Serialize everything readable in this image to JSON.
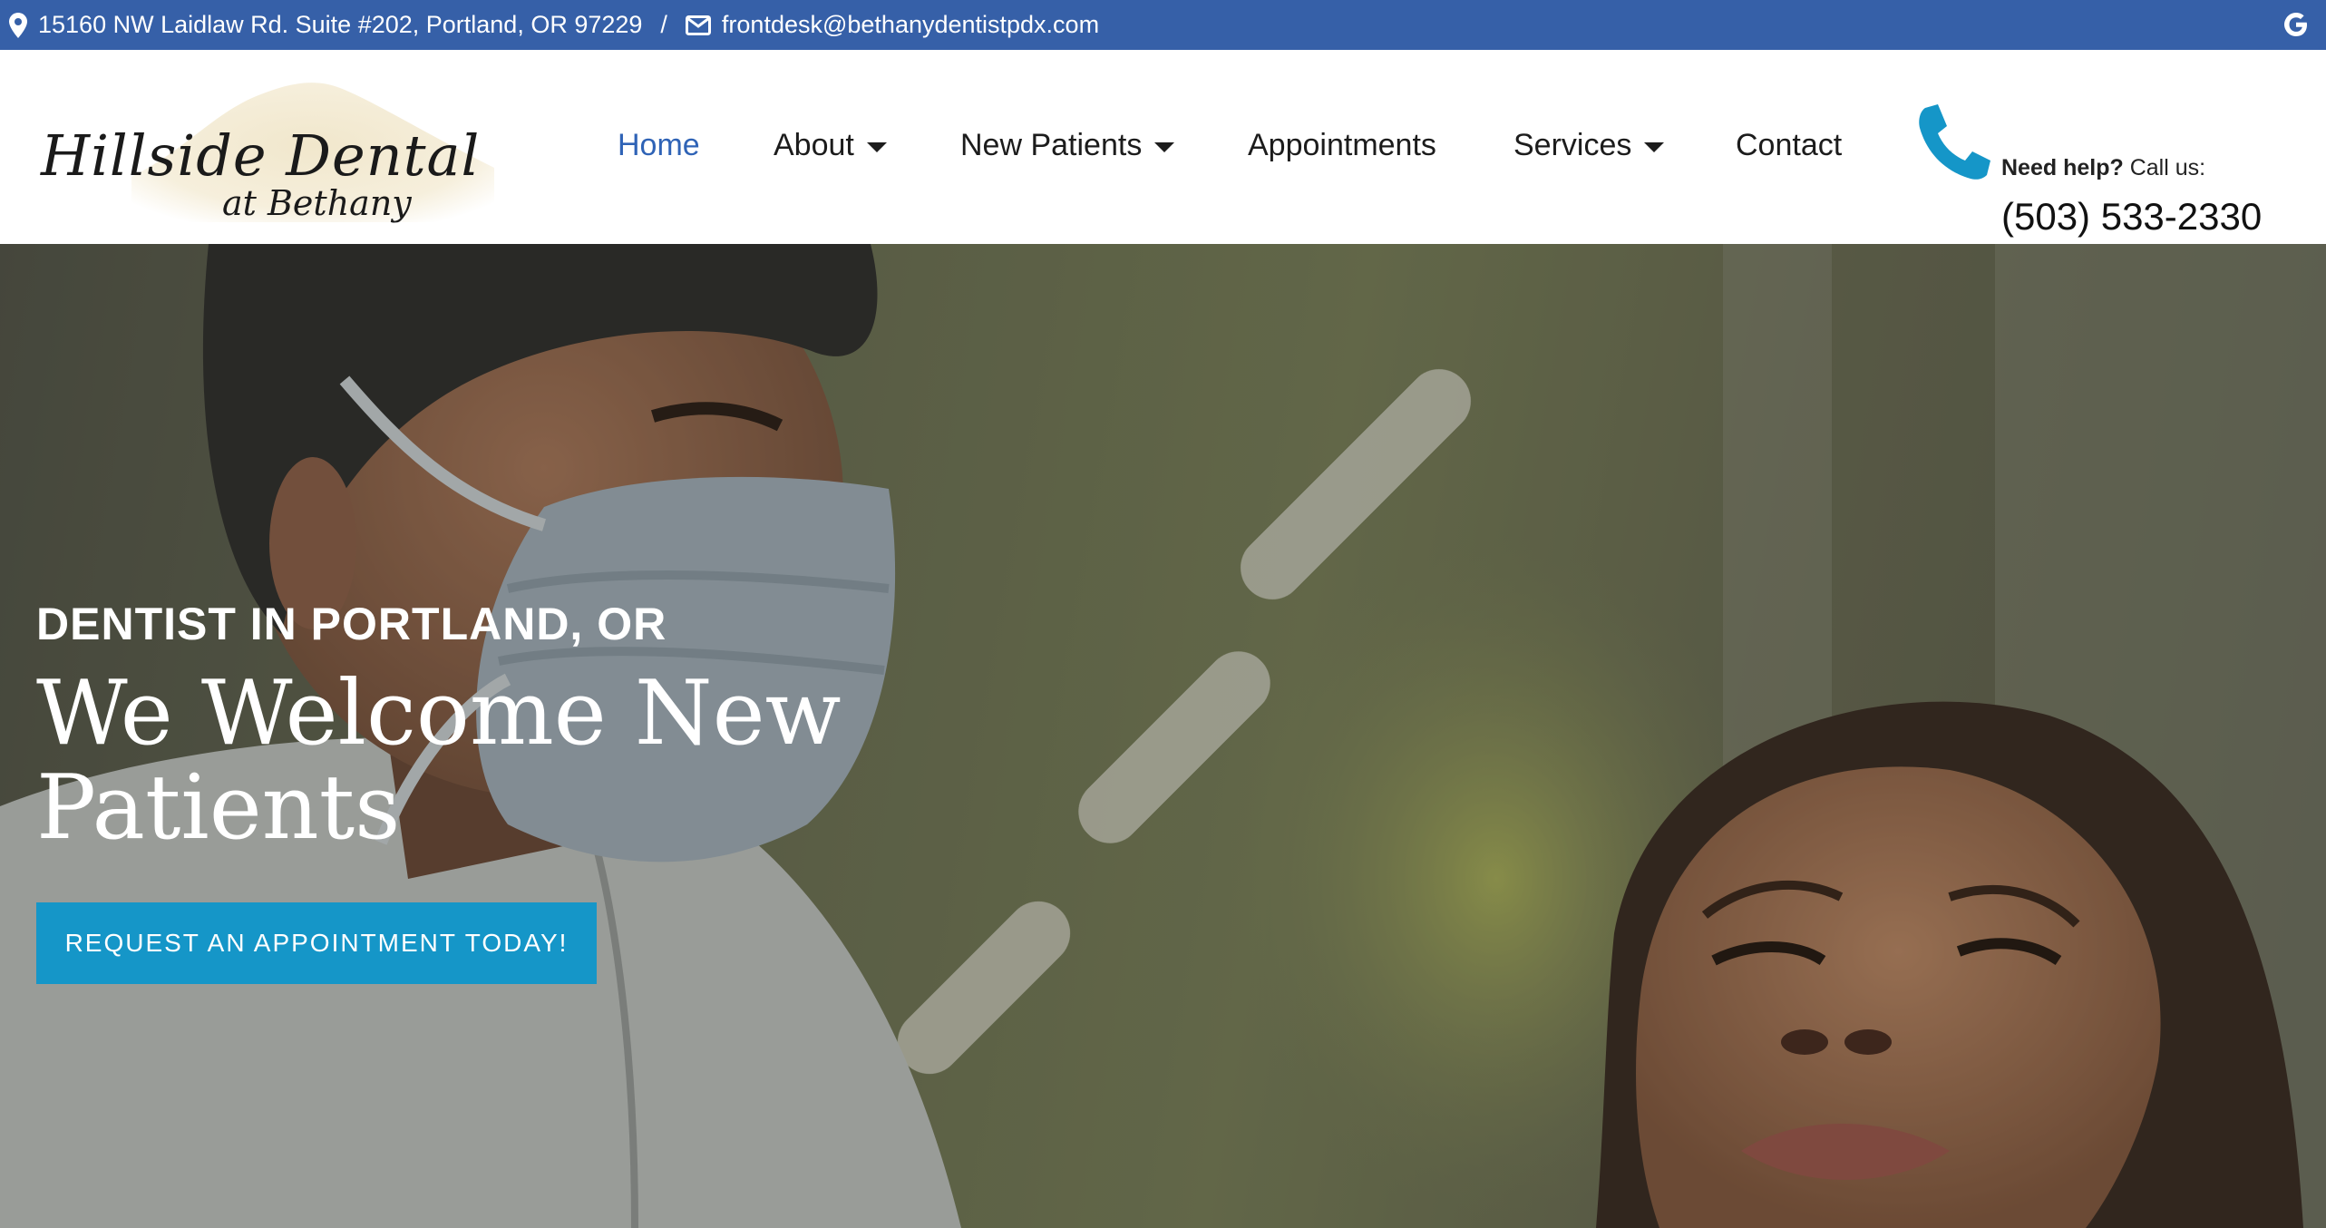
{
  "topbar": {
    "address": "15160 NW Laidlaw Rd. Suite #202, Portland, OR 97229",
    "separator": "/",
    "email": "frontdesk@bethanydentistpdx.com",
    "icons": [
      "map-marker-icon",
      "envelope-icon",
      "google-icon"
    ],
    "background": "#3660a8"
  },
  "logo": {
    "line1": "Hillside Dental",
    "line2": "at Bethany"
  },
  "nav": {
    "items": [
      {
        "label": "Home",
        "active": true,
        "dropdown": false
      },
      {
        "label": "About",
        "active": false,
        "dropdown": true
      },
      {
        "label": "New Patients",
        "active": false,
        "dropdown": true
      },
      {
        "label": "Appointments",
        "active": false,
        "dropdown": false
      },
      {
        "label": "Services",
        "active": false,
        "dropdown": true
      },
      {
        "label": "Contact",
        "active": false,
        "dropdown": false
      }
    ],
    "active_color": "#2f63b6"
  },
  "call": {
    "help_bold": "Need help?",
    "help_rest": " Call us:",
    "number": "(503) 533-2330",
    "icon": "phone-icon",
    "icon_color": "#1596c8"
  },
  "hero": {
    "kicker": "DENTIST IN PORTLAND, OR",
    "headline": "We Welcome New Patients",
    "cta": "REQUEST AN APPOINTMENT TODAY!",
    "cta_color": "#1596c8"
  }
}
